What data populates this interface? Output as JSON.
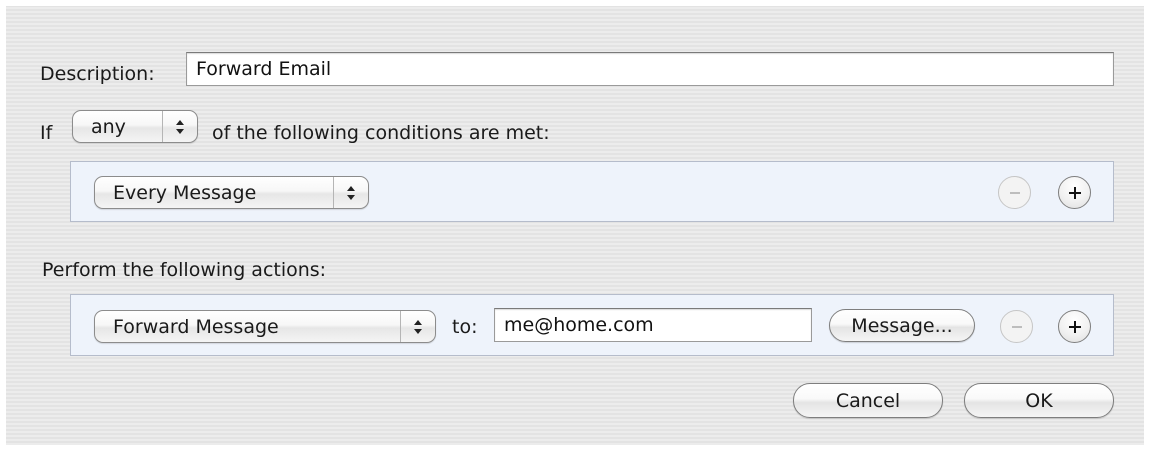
{
  "description": {
    "label": "Description:",
    "value": "Forward Email"
  },
  "condition_header": {
    "prefix": "If",
    "match_mode": "any",
    "suffix": "of the following conditions are met:"
  },
  "conditions": [
    {
      "criterion": "Every Message"
    }
  ],
  "actions_header": "Perform the following actions:",
  "actions": [
    {
      "action": "Forward Message",
      "to_label": "to:",
      "recipient": "me@home.com",
      "message_button": "Message..."
    }
  ],
  "buttons": {
    "cancel": "Cancel",
    "ok": "OK"
  }
}
